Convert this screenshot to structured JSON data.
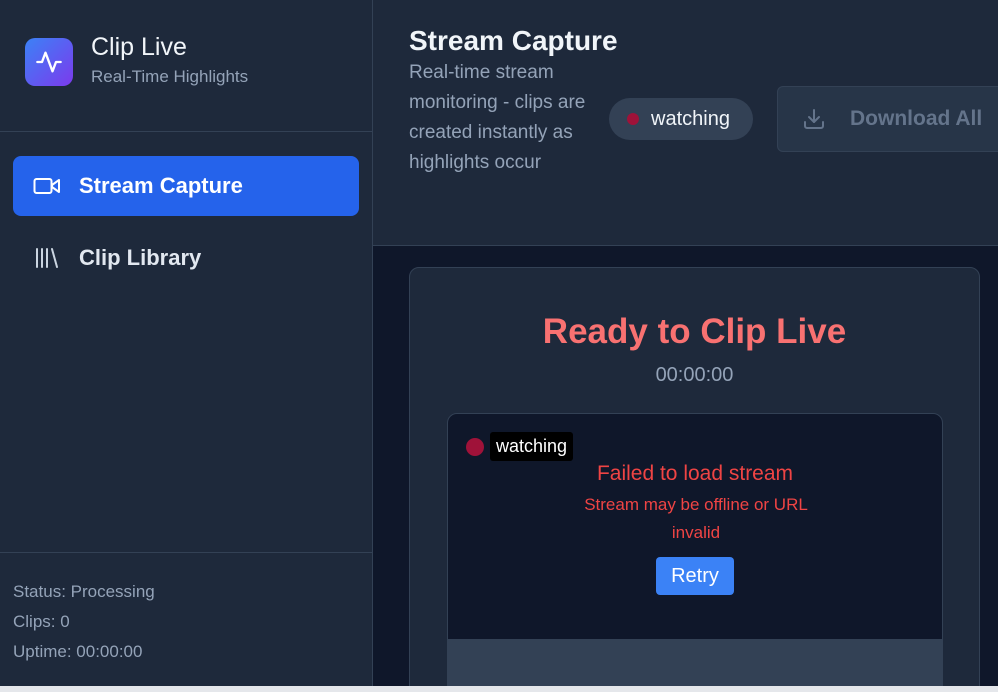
{
  "brand": {
    "title": "Clip Live",
    "subtitle": "Real-Time Highlights",
    "logo_icon": "activity-pulse-icon"
  },
  "nav": {
    "items": [
      {
        "label": "Stream Capture",
        "icon": "video-camera-icon",
        "active": true
      },
      {
        "label": "Clip Library",
        "icon": "library-icon",
        "active": false
      }
    ]
  },
  "sidebar_footer": {
    "status": "Status: Processing",
    "clips": "Clips: 0",
    "uptime": "Uptime: 00:00:00"
  },
  "header": {
    "title": "Stream Capture",
    "subtitle": "Real-time stream monitoring - clips are created instantly as highlights occur",
    "status_label": "watching",
    "download_label": "Download All",
    "download_icon": "download-icon"
  },
  "card": {
    "title": "Ready to Clip Live",
    "timer": "00:00:00"
  },
  "player": {
    "status_label": "watching",
    "error_title": "Failed to load stream",
    "error_subtitle": "Stream may be offline or URL invalid",
    "retry_label": "Retry"
  },
  "colors": {
    "accent": "#2563eb",
    "status_dot": "#9f1239",
    "error": "#ef4444",
    "title_red": "#f87171"
  }
}
